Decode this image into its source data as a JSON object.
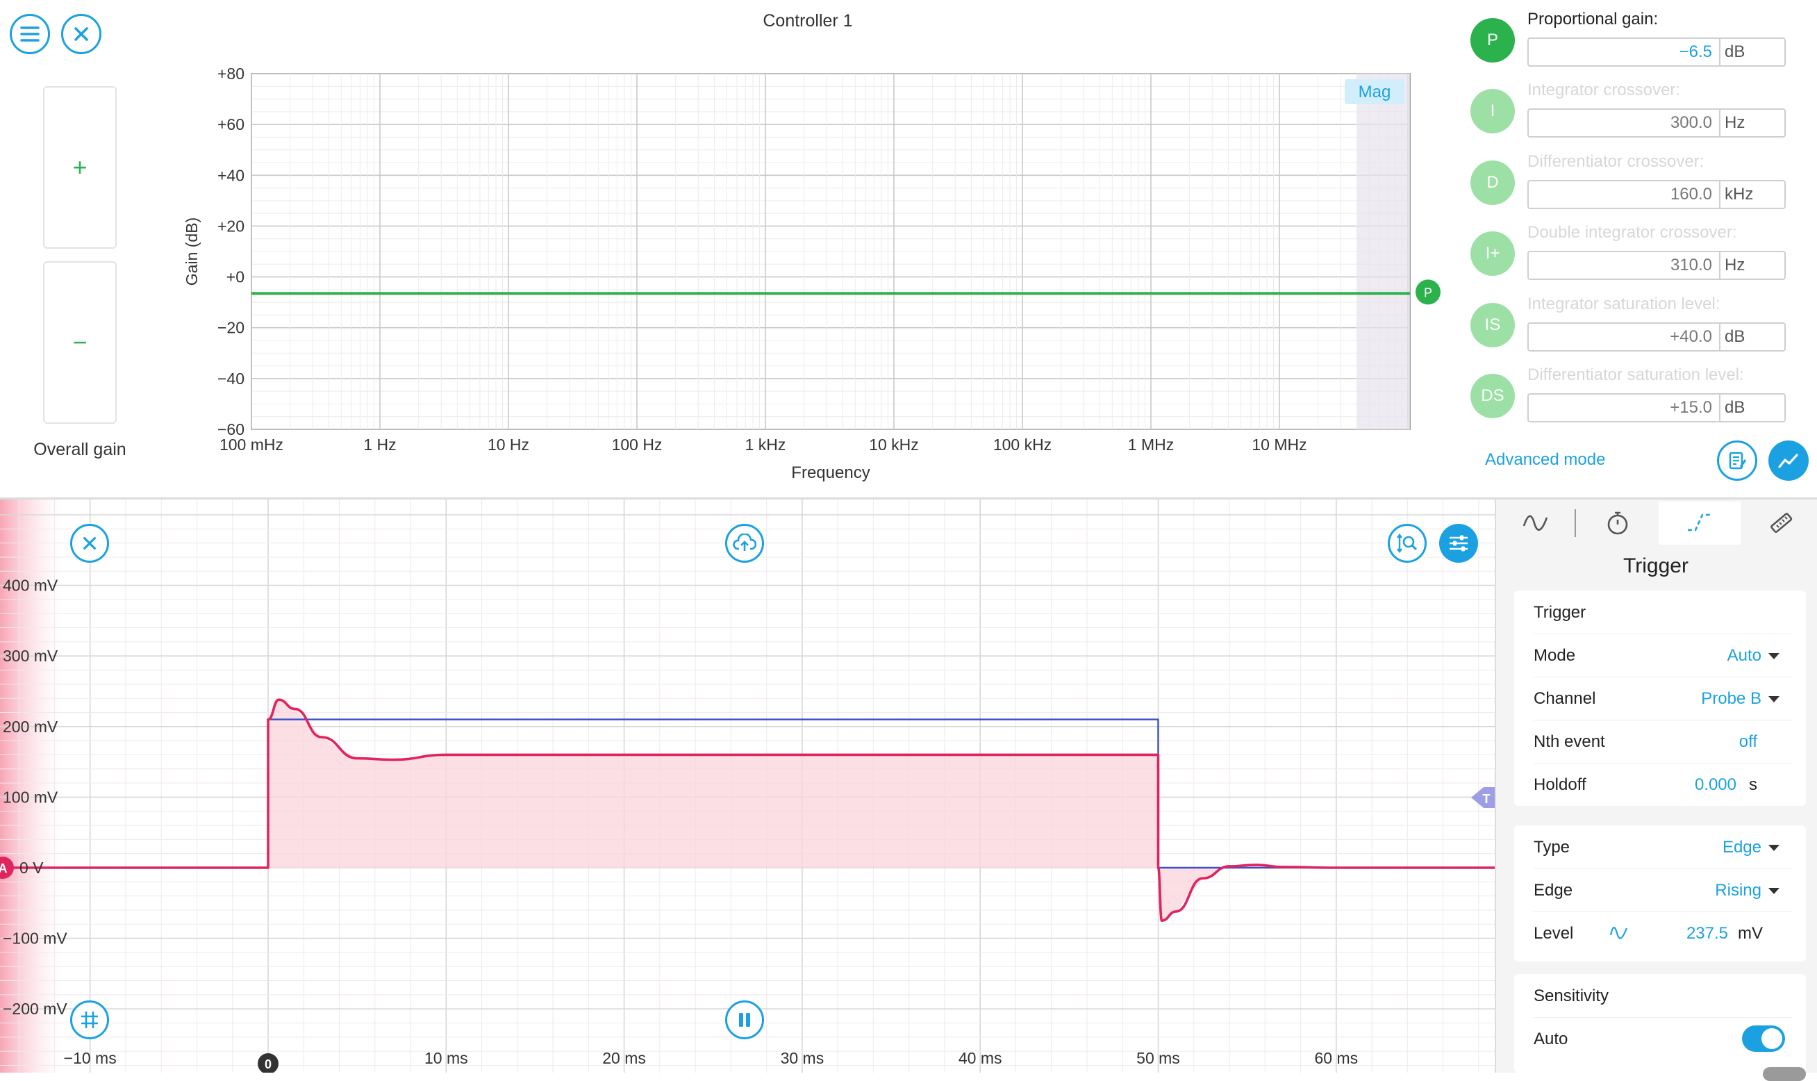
{
  "controller": {
    "title": "Controller 1"
  },
  "gain_buttons": {
    "plus": "+",
    "minus": "−",
    "label": "Overall gain"
  },
  "bode": {
    "ylabel": "Gain (dB)",
    "xlabel": "Frequency",
    "yticks": [
      "+80",
      "+60",
      "+40",
      "+20",
      "+0",
      "−20",
      "−40",
      "−60"
    ],
    "xticks": [
      "100 mHz",
      "1 Hz",
      "10 Hz",
      "100 Hz",
      "1 kHz",
      "10 kHz",
      "100 kHz",
      "1 MHz",
      "10 MHz"
    ],
    "mag_badge": "Mag",
    "marker": "P",
    "gain_db": -6.5
  },
  "pid": {
    "items": [
      {
        "badge": "P",
        "label": "Proportional gain:",
        "value": "−6.5",
        "unit": "dB",
        "active": true
      },
      {
        "badge": "I",
        "label": "Integrator crossover:",
        "value": "300.0",
        "unit": "Hz",
        "active": false
      },
      {
        "badge": "D",
        "label": "Differentiator crossover:",
        "value": "160.0",
        "unit": "kHz",
        "active": false
      },
      {
        "badge": "I+",
        "label": "Double integrator crossover:",
        "value": "310.0",
        "unit": "Hz",
        "active": false
      },
      {
        "badge": "IS",
        "label": "Integrator saturation level:",
        "value": "+40.0",
        "unit": "dB",
        "active": false
      },
      {
        "badge": "DS",
        "label": "Differentiator saturation level:",
        "value": "+15.0",
        "unit": "dB",
        "active": false
      }
    ],
    "advanced_mode": "Advanced mode"
  },
  "scope": {
    "yticks": [
      "400 mV",
      "300 mV",
      "200 mV",
      "100 mV",
      "0 V",
      "−100 mV",
      "−200 mV"
    ],
    "xticks": [
      "−10 ms",
      "0",
      "10 ms",
      "20 ms",
      "30 ms",
      "40 ms",
      "50 ms",
      "60 ms"
    ],
    "channel_marker": "A",
    "trigger_marker": "T",
    "zero_marker": "0"
  },
  "trigger_panel": {
    "title": "Trigger",
    "section1": {
      "header": "Trigger",
      "mode_label": "Mode",
      "mode_value": "Auto",
      "channel_label": "Channel",
      "channel_value": "Probe B",
      "nth_label": "Nth event",
      "nth_value": "off",
      "holdoff_label": "Holdoff",
      "holdoff_value": "0.000",
      "holdoff_unit": "s"
    },
    "section2": {
      "type_label": "Type",
      "type_value": "Edge",
      "edge_label": "Edge",
      "edge_value": "Rising",
      "level_label": "Level",
      "level_value": "237.5",
      "level_unit": "mV"
    },
    "section3": {
      "header": "Sensitivity",
      "auto_label": "Auto",
      "auto_on": true
    }
  },
  "chart_data": [
    {
      "type": "line",
      "title": "Controller 1",
      "xlabel": "Frequency",
      "ylabel": "Gain (dB)",
      "x_scale": "log",
      "xlim": [
        "100 mHz",
        "10 MHz+"
      ],
      "ylim": [
        -60,
        80
      ],
      "grid": true,
      "series": [
        {
          "values": [
            -6.5,
            -6.5,
            -6.5,
            -6.5,
            -6.5,
            -6.5,
            -6.5,
            -6.5,
            -6.5
          ],
          "color": "#2bb24c"
        }
      ]
    },
    {
      "type": "line",
      "xlim": [
        -10,
        70
      ],
      "ylim": [
        -250,
        450
      ],
      "grid": true,
      "series": [
        {
          "color": "#3a4fc8",
          "x": [
            -15,
            0,
            0,
            50,
            50,
            70
          ],
          "y": [
            0,
            0,
            210,
            210,
            0,
            0
          ]
        },
        {
          "color": "#e0245e",
          "x": [
            -15,
            0,
            0,
            0.6,
            1.5,
            3,
            5,
            7,
            10,
            20,
            30,
            40,
            50,
            50,
            50.2,
            51,
            52.5,
            54,
            55.5,
            57,
            60,
            70
          ],
          "y": [
            0,
            0,
            210,
            238,
            225,
            185,
            155,
            153,
            160,
            160,
            160,
            160,
            160,
            0,
            -75,
            -62,
            -15,
            2,
            4,
            1,
            0,
            0
          ]
        }
      ]
    }
  ]
}
